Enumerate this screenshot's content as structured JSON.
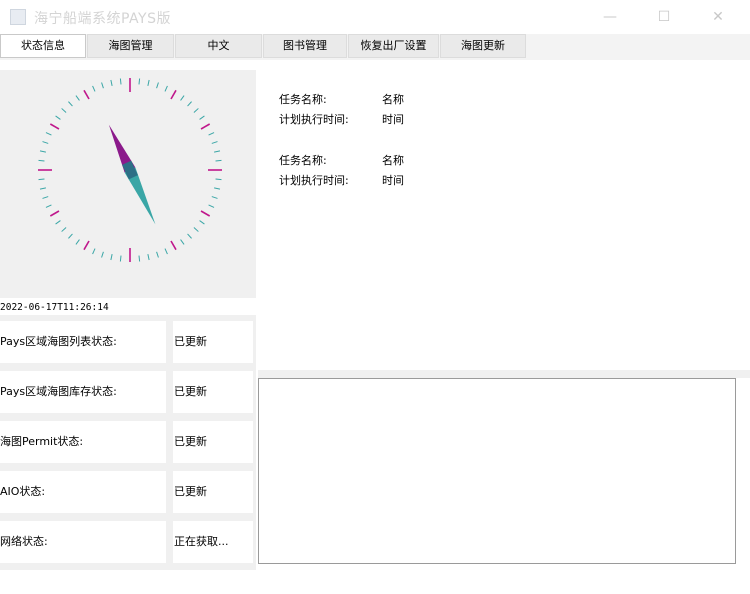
{
  "window": {
    "title": "海宁船端系统PAYS版",
    "minimize_glyph": "—",
    "maximize_glyph": "☐",
    "close_glyph": "✕"
  },
  "tabs": [
    {
      "label": "状态信息",
      "active": true
    },
    {
      "label": "海图管理",
      "active": false
    },
    {
      "label": "中文",
      "active": false
    },
    {
      "label": "图书管理",
      "active": false
    },
    {
      "label": "恢复出厂设置",
      "active": false
    },
    {
      "label": "海图更新",
      "active": false
    }
  ],
  "compass": {
    "heading_deg": 335,
    "needle_north_color": "#8b1a8b",
    "needle_south_color": "#3aa6a6",
    "cardinal_tick_color": "#c0178c",
    "minor_tick_color": "#3aa6a6"
  },
  "timestamp": "2022-06-17T11:26:14",
  "status": [
    {
      "label": "Pays区域海图列表状态:",
      "value": "已更新"
    },
    {
      "label": "Pays区域海图库存状态:",
      "value": "已更新"
    },
    {
      "label": "海图Permit状态:",
      "value": "已更新"
    },
    {
      "label": "AIO状态:",
      "value": "已更新"
    },
    {
      "label": "网络状态:",
      "value": "正在获取..."
    }
  ],
  "tasks": [
    {
      "name_label": "任务名称:",
      "name_value": "名称",
      "time_label": "计划执行时间:",
      "time_value": "时间"
    },
    {
      "name_label": "任务名称:",
      "name_value": "名称",
      "time_label": "计划执行时间:",
      "time_value": "时间"
    }
  ],
  "log_text": ""
}
